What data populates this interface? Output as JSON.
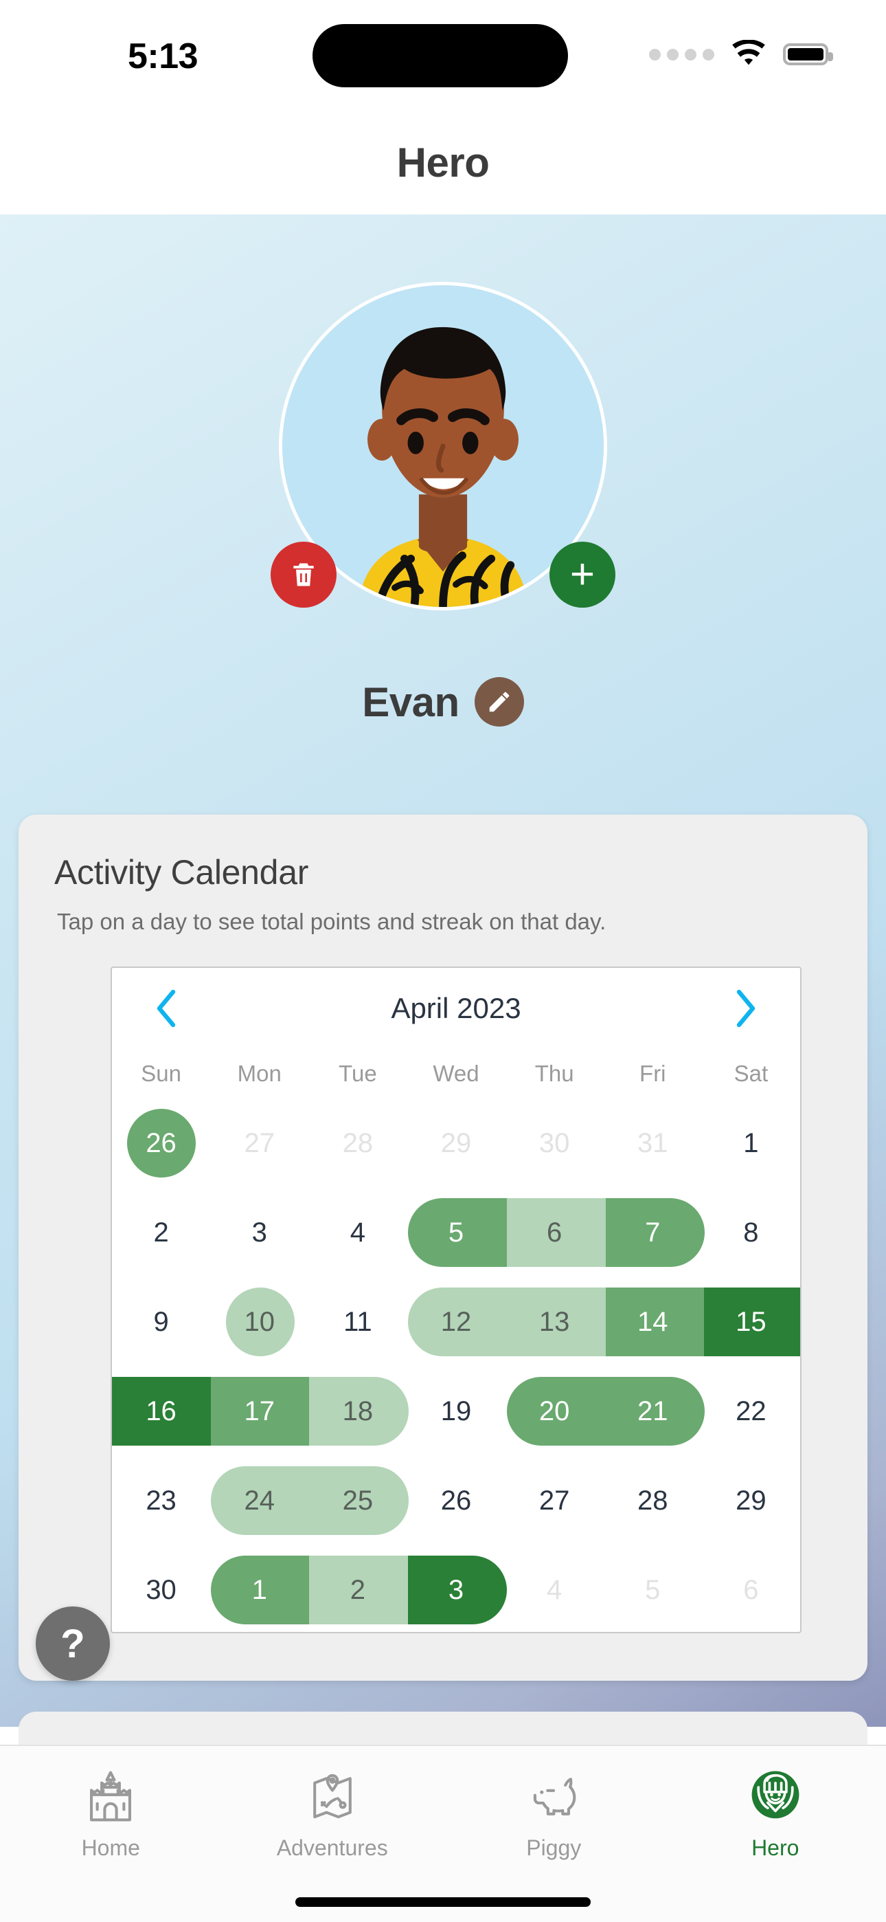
{
  "status_bar": {
    "time": "5:13",
    "signal_icon": "cellular-dots-icon",
    "wifi_icon": "wifi-icon",
    "battery_icon": "battery-full-icon"
  },
  "header": {
    "title": "Hero"
  },
  "profile": {
    "name": "Evan",
    "avatar_alt": "hero-avatar-illustration",
    "delete_button_label": "",
    "delete_icon": "trash-icon",
    "add_button_label": "+",
    "add_icon": "plus-icon",
    "edit_icon": "pencil-icon"
  },
  "calendar_card": {
    "title": "Activity Calendar",
    "subtitle": "Tap on a day to see total points and streak on that day.",
    "month_label": "April 2023",
    "prev_icon": "chevron-left-icon",
    "next_icon": "chevron-right-icon",
    "weekdays": [
      "Sun",
      "Mon",
      "Tue",
      "Wed",
      "Thu",
      "Fri",
      "Sat"
    ],
    "weeks": [
      [
        {
          "n": "26",
          "state": "mid",
          "shape": "circle"
        },
        {
          "n": "27",
          "state": "muted",
          "shape": "none"
        },
        {
          "n": "28",
          "state": "muted",
          "shape": "none"
        },
        {
          "n": "29",
          "state": "muted",
          "shape": "none"
        },
        {
          "n": "30",
          "state": "muted",
          "shape": "none"
        },
        {
          "n": "31",
          "state": "muted",
          "shape": "none"
        },
        {
          "n": "1",
          "state": "plain",
          "shape": "none"
        }
      ],
      [
        {
          "n": "2",
          "state": "plain",
          "shape": "none"
        },
        {
          "n": "3",
          "state": "plain",
          "shape": "none"
        },
        {
          "n": "4",
          "state": "plain",
          "shape": "none"
        },
        {
          "n": "5",
          "state": "mid",
          "shape": "start"
        },
        {
          "n": "6",
          "state": "light",
          "shape": "mid"
        },
        {
          "n": "7",
          "state": "mid",
          "shape": "end"
        },
        {
          "n": "8",
          "state": "plain",
          "shape": "none"
        }
      ],
      [
        {
          "n": "9",
          "state": "plain",
          "shape": "none"
        },
        {
          "n": "10",
          "state": "light",
          "shape": "circle"
        },
        {
          "n": "11",
          "state": "plain",
          "shape": "none"
        },
        {
          "n": "12",
          "state": "light",
          "shape": "start"
        },
        {
          "n": "13",
          "state": "light",
          "shape": "mid"
        },
        {
          "n": "14",
          "state": "mid",
          "shape": "mid"
        },
        {
          "n": "15",
          "state": "dark",
          "shape": "mid"
        }
      ],
      [
        {
          "n": "16",
          "state": "dark",
          "shape": "mid"
        },
        {
          "n": "17",
          "state": "mid",
          "shape": "mid"
        },
        {
          "n": "18",
          "state": "light",
          "shape": "end"
        },
        {
          "n": "19",
          "state": "plain",
          "shape": "none"
        },
        {
          "n": "20",
          "state": "mid",
          "shape": "start"
        },
        {
          "n": "21",
          "state": "mid",
          "shape": "end"
        },
        {
          "n": "22",
          "state": "plain",
          "shape": "none"
        }
      ],
      [
        {
          "n": "23",
          "state": "plain",
          "shape": "none"
        },
        {
          "n": "24",
          "state": "light",
          "shape": "start"
        },
        {
          "n": "25",
          "state": "light",
          "shape": "end"
        },
        {
          "n": "26",
          "state": "plain",
          "shape": "none"
        },
        {
          "n": "27",
          "state": "plain",
          "shape": "none"
        },
        {
          "n": "28",
          "state": "plain",
          "shape": "none"
        },
        {
          "n": "29",
          "state": "plain",
          "shape": "none"
        }
      ],
      [
        {
          "n": "30",
          "state": "plain",
          "shape": "none"
        },
        {
          "n": "1",
          "state": "mid",
          "shape": "start"
        },
        {
          "n": "2",
          "state": "light",
          "shape": "mid"
        },
        {
          "n": "3",
          "state": "dark",
          "shape": "end"
        },
        {
          "n": "4",
          "state": "muted",
          "shape": "none"
        },
        {
          "n": "5",
          "state": "muted",
          "shape": "none"
        },
        {
          "n": "6",
          "state": "muted",
          "shape": "none"
        }
      ]
    ]
  },
  "help_button": {
    "label": "?",
    "icon": "question-mark-icon"
  },
  "tabbar": {
    "items": [
      {
        "label": "Home",
        "icon": "castle-icon",
        "active": false
      },
      {
        "label": "Adventures",
        "icon": "treasure-map-icon",
        "active": false
      },
      {
        "label": "Piggy",
        "icon": "piggy-bank-icon",
        "active": false
      },
      {
        "label": "Hero",
        "icon": "knight-helmet-icon",
        "active": true
      }
    ]
  },
  "colors": {
    "accent_green": "#1f7a32",
    "level_light": "#b4d5b8",
    "level_mid": "#6aa96f",
    "level_dark": "#2a8036",
    "delete_red": "#d32f2f",
    "chevron_blue": "#0fb4ef",
    "card_bg": "#efefef",
    "edit_brown": "#7a5a47"
  }
}
